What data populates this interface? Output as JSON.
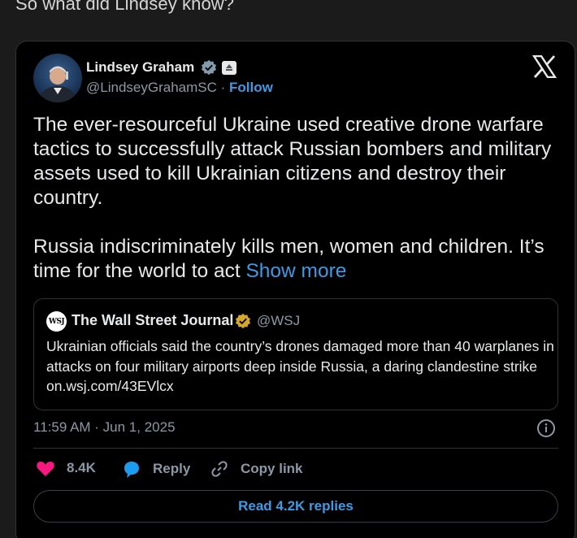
{
  "intro_text": "So what did Lindsey know?",
  "colors": {
    "accent": "#3d9ae5",
    "like": "#f91880",
    "reply_icon": "#1d9bf0",
    "background": "#1b1b1c"
  },
  "tweet": {
    "author_name": "Lindsey Graham",
    "handle": "@LindseyGrahamSC",
    "separator": "·",
    "follow_label": "Follow",
    "body": "The ever-resourceful Ukraine used creative drone warfare tactics to successfully attack Russian bombers and military assets used to kill Ukrainian citizens and destroy their country.\n\nRussia indiscriminately kills men, women and children. It’s time for the world to act ",
    "show_more": "Show more",
    "timestamp": "11:59 AM · Jun 1, 2025",
    "like_count": "8.4K",
    "reply_label": "Reply",
    "copy_link_label": "Copy link",
    "read_replies_label": "Read 4.2K replies",
    "icons": [
      "verified-badge-icon",
      "affiliate-badge-icon",
      "x-logo-icon",
      "info-icon",
      "heart-icon",
      "reply-bubble-icon",
      "link-icon"
    ]
  },
  "quote": {
    "logo_text": "WSJ",
    "name": "The Wall Street Journal",
    "handle": "@WSJ",
    "text": "Ukrainian officials said the country’s drones damaged more than 40 warplanes in attacks on four military airports deep inside Russia, a daring clandestine strike  on.wsj.com/43EVlcx"
  }
}
